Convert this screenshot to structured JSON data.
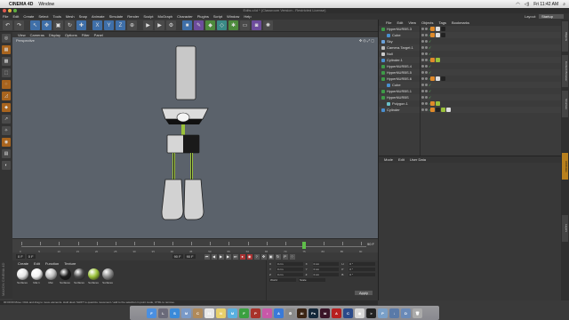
{
  "mac": {
    "app": "CINEMA 4D",
    "menu": [
      "Window"
    ],
    "clock": "Fri 11:42 AM",
    "right_icons": [
      "wifi-icon",
      "volume-icon",
      "search-icon"
    ]
  },
  "window_title": "Edits.c4d * (Classroom Version - Restricted License)",
  "c4d_menu": [
    "File",
    "Edit",
    "Create",
    "Select",
    "Tools",
    "Mesh",
    "Snap",
    "Animate",
    "Simulate",
    "Render",
    "Sculpt",
    "MoGraph",
    "Character",
    "Plugins",
    "Script",
    "Window",
    "Help"
  ],
  "layout": {
    "label": "Layout:",
    "value": "Startup"
  },
  "viewport": {
    "menu": [
      "View",
      "Cameras",
      "Display",
      "Options",
      "Filter",
      "Panel"
    ],
    "title": "Perspective"
  },
  "timeline": {
    "ticks": [
      "0",
      "5",
      "10",
      "15",
      "20",
      "25",
      "30",
      "35",
      "40",
      "45",
      "50",
      "55",
      "60",
      "65",
      "70",
      "75",
      "80",
      "85",
      "90"
    ],
    "current_frame": "75",
    "end_frame": "90 F"
  },
  "transport": {
    "start_field": "0 F",
    "current_field": "0 F",
    "end_field": "90 F",
    "max_field": "90 F"
  },
  "material": {
    "menu": [
      "Create",
      "Edit",
      "Function",
      "Texture"
    ],
    "items": [
      {
        "name": "Surfaces",
        "color": "#e6e6e6"
      },
      {
        "name": "Mat.1",
        "color": "#f2f2f2"
      },
      {
        "name": "Mat",
        "color": "#bdbdbd"
      },
      {
        "name": "Surfaces",
        "color": "#1c1c1c"
      },
      {
        "name": "Surfaces",
        "color": "#4a4a4a"
      },
      {
        "name": "Surfaces",
        "color": "#9ac13a"
      },
      {
        "name": "Surfaces",
        "color": "#8a8a8a"
      }
    ]
  },
  "coords": {
    "rows": [
      {
        "a": "X",
        "av": "0 cm",
        "b": "X",
        "bv": "0 cm",
        "c": "H",
        "cv": "0 °"
      },
      {
        "a": "Y",
        "av": "0 cm",
        "b": "Y",
        "bv": "0 cm",
        "c": "P",
        "cv": "0 °"
      },
      {
        "a": "Z",
        "av": "0 cm",
        "b": "Z",
        "bv": "0 cm",
        "c": "B",
        "cv": "0 °"
      }
    ],
    "mode_a": "World",
    "mode_b": "Scale",
    "apply": "Apply"
  },
  "objects": {
    "menu": [
      "File",
      "Edit",
      "View",
      "Objects",
      "Tags",
      "Bookmarks"
    ],
    "rows": [
      {
        "name": "HyperNURBS.3",
        "indent": 0,
        "icon": "#3e9a48",
        "tags": [
          "#e08a2a",
          "#dddddd",
          "#222222"
        ]
      },
      {
        "name": "Cube",
        "indent": 1,
        "icon": "#4a8fd0",
        "tags": [
          "#e08a2a",
          "#dddddd",
          "#222222"
        ]
      },
      {
        "name": "Sky",
        "indent": 0,
        "icon": "#6aa0d8",
        "tags": []
      },
      {
        "name": "Camera.Target.1",
        "indent": 0,
        "icon": "#bbbbbb",
        "tags": []
      },
      {
        "name": "Null",
        "indent": 0,
        "icon": "#cccccc",
        "tags": []
      },
      {
        "name": "Cylinder.1",
        "indent": 0,
        "icon": "#4a8fd0",
        "tags": [
          "#e08a2a",
          "#9ac13a"
        ]
      },
      {
        "name": "HyperNURBS.4",
        "indent": 0,
        "icon": "#3e9a48",
        "tags": []
      },
      {
        "name": "HyperNURBS.5",
        "indent": 0,
        "icon": "#3e9a48",
        "tags": []
      },
      {
        "name": "HyperNURBS.6",
        "indent": 0,
        "icon": "#3e9a48",
        "tags": [
          "#e08a2a",
          "#dddddd",
          "#222222"
        ]
      },
      {
        "name": "Cube",
        "indent": 1,
        "icon": "#4a8fd0",
        "tags": []
      },
      {
        "name": "HyperNURBS.1",
        "indent": 0,
        "icon": "#3e9a48",
        "tags": []
      },
      {
        "name": "HyperNURBS",
        "indent": 0,
        "icon": "#3e9a48",
        "tags": []
      },
      {
        "name": "Polygon.1",
        "indent": 1,
        "icon": "#6bc0c8",
        "tags": [
          "#e08a2a",
          "#9ac13a"
        ]
      },
      {
        "name": "Cylinder",
        "indent": 0,
        "icon": "#4a8fd0",
        "tags": [
          "#e08a2a",
          "#222222",
          "#9ac13a",
          "#dddddd"
        ]
      }
    ]
  },
  "attributes": {
    "menu": [
      "Mode",
      "Edit",
      "User Data"
    ]
  },
  "side_tabs": [
    "Objects",
    "Content Browser",
    "Structure",
    "Attributes",
    "Layers"
  ],
  "status": "00:00:00      Move: Click and drag to move elements. Hold down SHIFT to quantize movement / add to the selection in point mode, CTRL to remove.",
  "dock": [
    {
      "name": "finder",
      "color": "#4a8fe0",
      "glyph": "F"
    },
    {
      "name": "launchpad",
      "color": "#6a6a7a",
      "glyph": "L"
    },
    {
      "name": "safari",
      "color": "#3a8ad8",
      "glyph": "S"
    },
    {
      "name": "mail",
      "color": "#7a9ac8",
      "glyph": "M"
    },
    {
      "name": "contacts",
      "color": "#b08a5a",
      "glyph": "C"
    },
    {
      "name": "calendar",
      "color": "#e8e8e8",
      "glyph": "31"
    },
    {
      "name": "notes",
      "color": "#e8d06a",
      "glyph": "N"
    },
    {
      "name": "messages",
      "color": "#5ab0e0",
      "glyph": "M"
    },
    {
      "name": "facetime",
      "color": "#3aa040",
      "glyph": "F"
    },
    {
      "name": "photo-booth",
      "color": "#a8322a",
      "glyph": "P"
    },
    {
      "name": "itunes",
      "color": "#c858a8",
      "glyph": "♪"
    },
    {
      "name": "app-store",
      "color": "#3a7ad8",
      "glyph": "A"
    },
    {
      "name": "system-prefs",
      "color": "#8a8a8a",
      "glyph": "⚙"
    },
    {
      "name": "illustrator",
      "color": "#3a2414",
      "glyph": "Ai"
    },
    {
      "name": "photoshop",
      "color": "#14283a",
      "glyph": "Ps"
    },
    {
      "name": "indesign",
      "color": "#3a1428",
      "glyph": "Id"
    },
    {
      "name": "acrobat",
      "color": "#b82020",
      "glyph": "A"
    },
    {
      "name": "cinema4d",
      "color": "#2a4a8a",
      "glyph": "C"
    },
    {
      "name": "chrome",
      "color": "#d8d8d8",
      "glyph": "◉"
    },
    {
      "name": "terminal",
      "color": "#222222",
      "glyph": ">"
    },
    {
      "name": "preview",
      "color": "#7aa0c8",
      "glyph": "P"
    },
    {
      "name": "downloads",
      "color": "#5a7aa8",
      "glyph": "↓"
    },
    {
      "name": "documents",
      "color": "#6a8ab8",
      "glyph": "D"
    },
    {
      "name": "trash",
      "color": "#aaaaaa",
      "glyph": "🗑"
    }
  ]
}
